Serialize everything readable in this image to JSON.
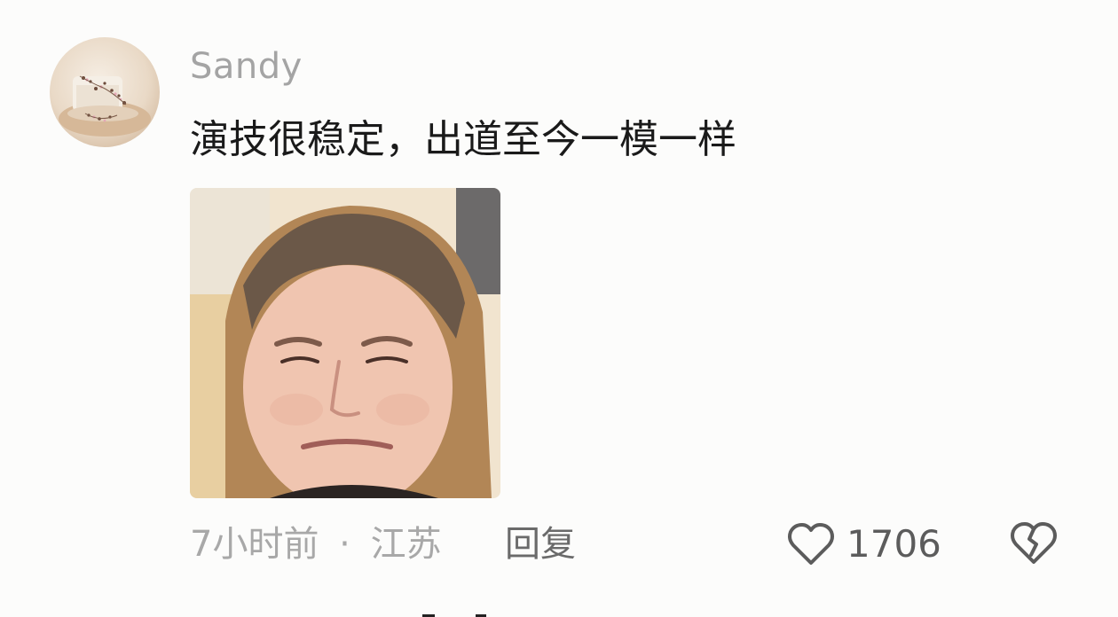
{
  "comment": {
    "username": "Sandy",
    "text": "演技很稳定，出道至今一模一样",
    "time": "7小时前",
    "separator": "·",
    "location": "江苏",
    "reply_label": "回复",
    "like_count": "1706"
  },
  "icons": {
    "like": "heart-outline-icon",
    "dislike": "broken-heart-icon"
  },
  "colors": {
    "username": "#a4a4a4",
    "text": "#1a1a1a",
    "meta": "#a8a8a8",
    "icon": "#5c5c5c"
  }
}
